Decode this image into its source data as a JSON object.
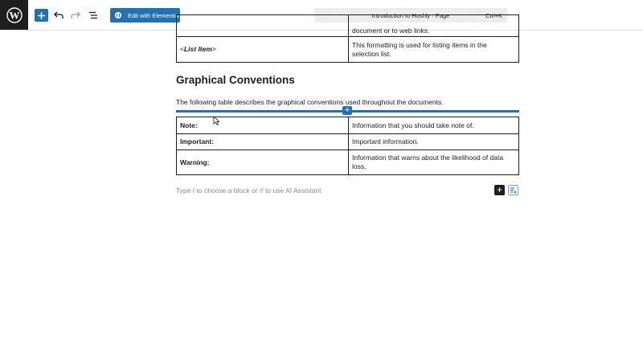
{
  "toolbar": {
    "elementor_label": "Edit with Elementor",
    "document_title": "Introduction to Hushly · Page",
    "shortcut": "Ctrl+K"
  },
  "table_top": {
    "rows": [
      {
        "term": "",
        "description": "document or to web links."
      },
      {
        "term_prefix": "<",
        "term": "List Item",
        "term_suffix": ">",
        "description": "This formatting is used for listing items in the selection list."
      }
    ]
  },
  "section": {
    "heading": "Graphical Conventions",
    "intro": "The following table describes the graphical conventions used throughout the documents."
  },
  "table_conventions": {
    "rows": [
      {
        "label": "Note:",
        "description": "Information that you should take note of."
      },
      {
        "label": "Important:",
        "description": "Important information."
      },
      {
        "label": "Warning:",
        "description": "Information that warns about the likelihood of data loss."
      }
    ]
  },
  "editor": {
    "placeholder": "Type / to choose a block or // to use AI Assistant"
  },
  "colors": {
    "accent": "#2271b1",
    "dark": "#1e1e1e"
  }
}
